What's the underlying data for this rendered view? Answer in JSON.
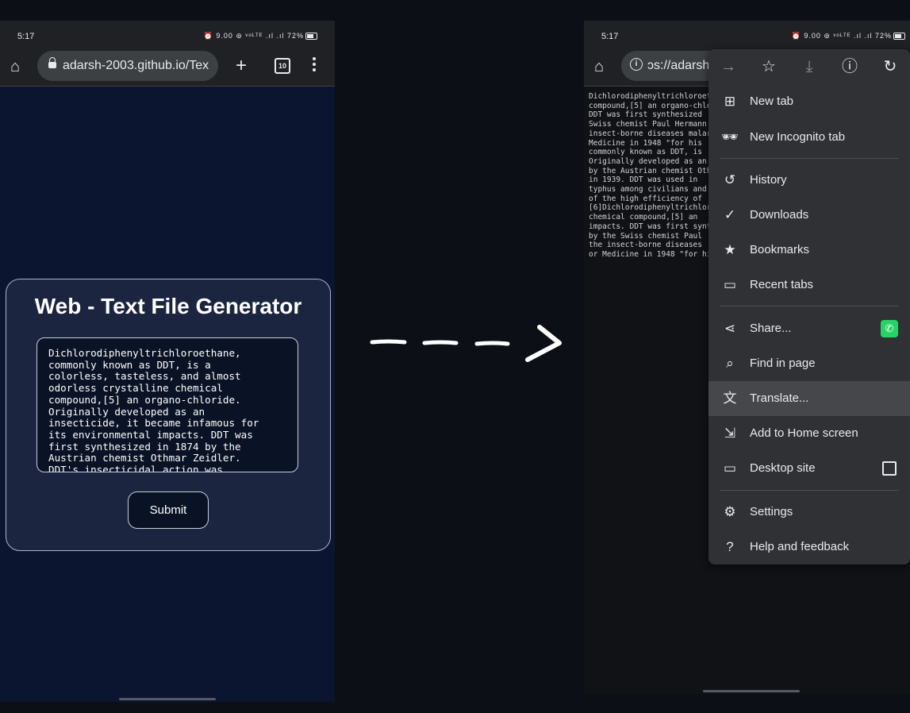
{
  "status": {
    "time": "5:17",
    "icons": "⏰ 9.00 ⊚ ᵛᵒᴸᵀᴱ .ıl .ıl 72%"
  },
  "left_phone": {
    "url": "adarsh-2003.github.io/Tex",
    "tab_count": "10",
    "title": "Web - Text File Generator",
    "textarea_value": "Dichlorodiphenyltrichloroethane, commonly known as DDT, is a colorless, tasteless, and almost odorless crystalline chemical compound,[5] an organo-chloride. Originally developed as an insecticide, it became infamous for its environmental impacts. DDT was first synthesized in 1874 by the Austrian chemist Othmar Zeidler. DDT's insecticidal action was",
    "submit_label": "Submit"
  },
  "right_phone": {
    "url": "ɔs://adarsh",
    "page_text": "Dichlorodiphenyltrichloroethane\ncompound,[5] an organo-chloride\nDDT was first synthesized\nSwiss chemist Paul Hermann\ninsect-borne diseases malaria\nMedicine in 1948 \"for his\ncommonly known as DDT, is\nOriginally developed as an\nby the Austrian chemist Othmar\nin 1939. DDT was used in\ntyphus among civilians and\nof the high efficiency of\n[6]Dichlorodiphenyltrichloro\nchemical compound,[5] an\nimpacts. DDT was first synthesized\nby the Swiss chemist Paul\nthe insect-borne diseases\nor Medicine in 1948 \"for his",
    "menu": {
      "items": [
        {
          "label": "New tab"
        },
        {
          "label": "New Incognito tab"
        },
        {
          "label": "History"
        },
        {
          "label": "Downloads"
        },
        {
          "label": "Bookmarks"
        },
        {
          "label": "Recent tabs"
        },
        {
          "label": "Share..."
        },
        {
          "label": "Find in page"
        },
        {
          "label": "Translate..."
        },
        {
          "label": "Add to Home screen"
        },
        {
          "label": "Desktop site"
        },
        {
          "label": "Settings"
        },
        {
          "label": "Help and feedback"
        }
      ]
    }
  },
  "colors": {
    "page_bg": "#0c1530",
    "menu_bg": "#303134",
    "whatsapp": "#25d366"
  }
}
